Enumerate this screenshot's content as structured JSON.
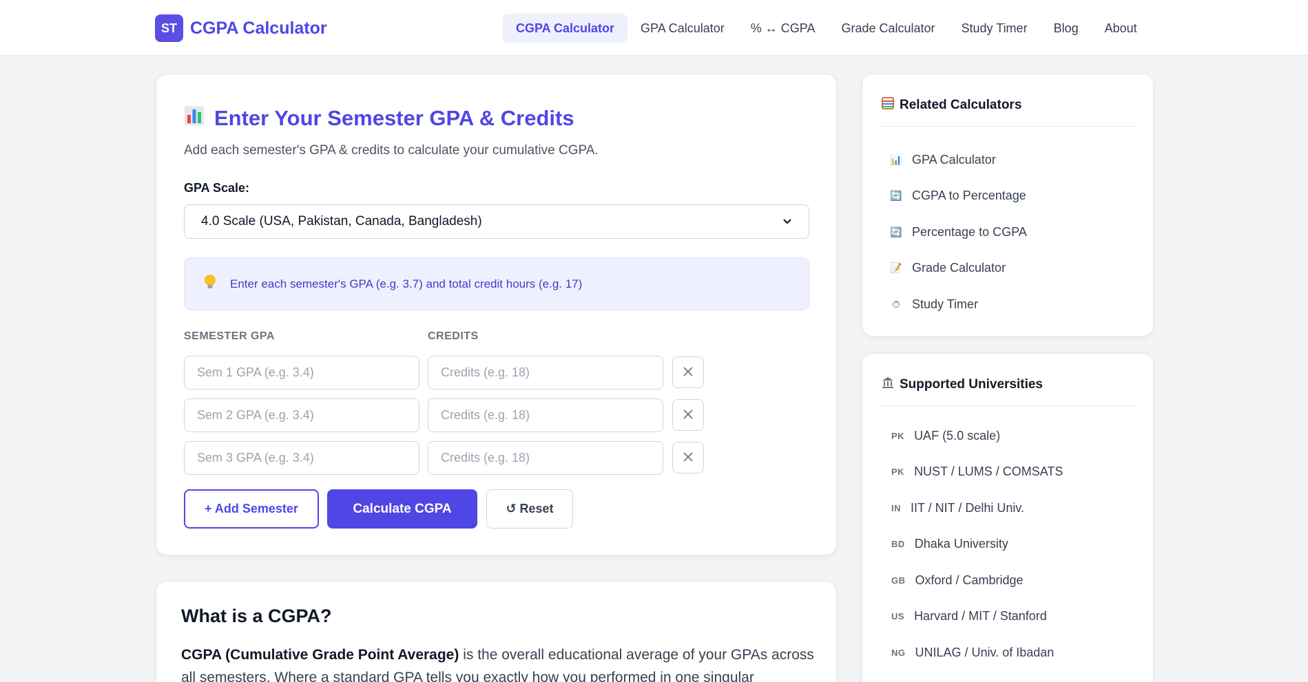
{
  "header": {
    "logo_badge": "ST",
    "logo_text": "CGPA Calculator",
    "nav": [
      {
        "label": "CGPA Calculator",
        "active": true
      },
      {
        "label": "GPA Calculator"
      },
      {
        "label": "% ↔ CGPA"
      },
      {
        "label": "Grade Calculator"
      },
      {
        "label": "Study Timer"
      },
      {
        "label": "Blog"
      },
      {
        "label": "About"
      }
    ]
  },
  "main": {
    "title": "Enter Your Semester GPA & Credits",
    "subtitle": "Add each semester's GPA & credits to calculate your cumulative CGPA.",
    "scale_label": "GPA Scale:",
    "scale_value": "4.0 Scale (USA, Pakistan, Canada, Bangladesh)",
    "hint": "Enter each semester's GPA (e.g. 3.7) and total credit hours (e.g. 17)",
    "col_gpa": "SEMESTER GPA",
    "col_credits": "CREDITS",
    "rows": [
      {
        "gpa_placeholder": "Sem 1 GPA (e.g. 3.4)",
        "credits_placeholder": "Credits (e.g. 18)"
      },
      {
        "gpa_placeholder": "Sem 2 GPA (e.g. 3.4)",
        "credits_placeholder": "Credits (e.g. 18)"
      },
      {
        "gpa_placeholder": "Sem 3 GPA (e.g. 3.4)",
        "credits_placeholder": "Credits (e.g. 18)"
      }
    ],
    "add_label": "+ Add Semester",
    "calc_label": "Calculate CGPA",
    "reset_label": "↺ Reset"
  },
  "about": {
    "title": "What is a CGPA?",
    "bold": "CGPA (Cumulative Grade Point Average)",
    "text": " is the overall educational average of your GPAs across all semesters. Where a standard GPA tells you exactly how you performed in one singular"
  },
  "related": {
    "title": "Related Calculators",
    "items": [
      {
        "icon": "📊",
        "label": "GPA Calculator"
      },
      {
        "icon": "🔄",
        "label": "CGPA to Percentage"
      },
      {
        "icon": "🔄",
        "label": "Percentage to CGPA"
      },
      {
        "icon": "📝",
        "label": "Grade Calculator"
      },
      {
        "icon": "⏱",
        "label": "Study Timer"
      }
    ]
  },
  "universities": {
    "title": "Supported Universities",
    "items": [
      {
        "flag": "PK",
        "label": "UAF (5.0 scale)"
      },
      {
        "flag": "PK",
        "label": "NUST / LUMS / COMSATS"
      },
      {
        "flag": "IN",
        "label": "IIT / NIT / Delhi Univ."
      },
      {
        "flag": "BD",
        "label": "Dhaka University"
      },
      {
        "flag": "GB",
        "label": "Oxford / Cambridge"
      },
      {
        "flag": "US",
        "label": "Harvard / MIT / Stanford"
      },
      {
        "flag": "NG",
        "label": "UNILAG / Univ. of Ibadan"
      }
    ]
  },
  "colors": {
    "accent": "#4f46e5",
    "background": "#f3f4f6",
    "hint_bg": "#eef1fd"
  }
}
